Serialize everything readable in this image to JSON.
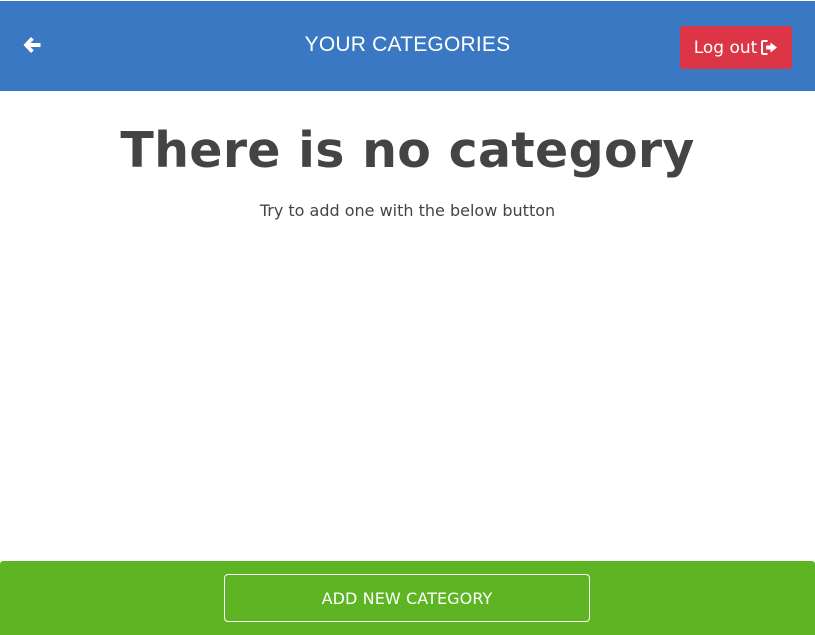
{
  "header": {
    "back_icon": "arrow-left-icon",
    "title": "YOUR CATEGORIES",
    "logout_label": "Log out",
    "logout_icon": "sign-out-icon"
  },
  "main": {
    "empty_title": "There is no category",
    "empty_subtitle": "Try to add one with the below button"
  },
  "footer": {
    "add_label": "ADD NEW CATEGORY"
  },
  "colors": {
    "header_bg": "#3a78c3",
    "logout_bg": "#dc3545",
    "footer_bg": "#5eb524",
    "text": "#444444"
  }
}
